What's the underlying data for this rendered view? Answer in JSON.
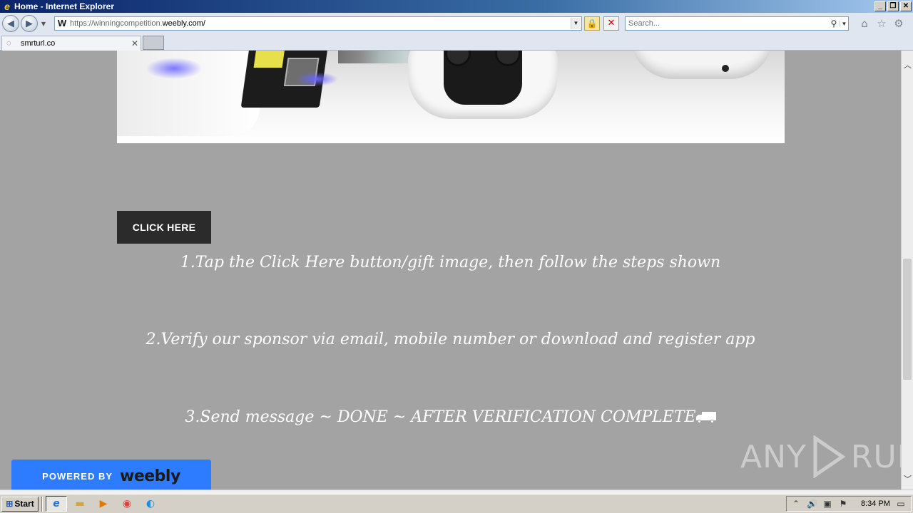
{
  "window": {
    "title": "Home - Internet Explorer",
    "controls": {
      "minimize": "_",
      "maximize": "❐",
      "close": "✕"
    }
  },
  "navbar": {
    "url_scheme": "https://",
    "url_sub": "winningcompetition.",
    "url_host": "weebly.com/",
    "site_icon": "W",
    "search_placeholder": "Search..."
  },
  "tabs": [
    {
      "label": "smrturl.co"
    }
  ],
  "page": {
    "cta_label": "CLICK HERE",
    "steps": [
      "1.Tap the Click Here button/gift image, then follow the steps shown",
      "2.Verify our sponsor via email, mobile number or download and register app",
      "3.Send message ~ DONE ~ AFTER VERIFICATION COMPLETE"
    ],
    "powered_label": "POWERED BY",
    "powered_brand": "weebly"
  },
  "watermark": {
    "left": "ANY",
    "right": "RUN"
  },
  "taskbar": {
    "start_label": "Start",
    "clock": "8:34 PM"
  },
  "icons": {
    "back": "back-arrow-icon",
    "forward": "forward-arrow-icon",
    "home": "home-icon",
    "favorites": "star-icon",
    "tools": "gear-icon",
    "lock": "lock-icon",
    "stop": "stop-icon",
    "search": "search-icon"
  },
  "colors": {
    "page_bg": "#a3a3a3",
    "cta_bg": "#2b2b2b",
    "weebly_blue": "#2d7cff"
  }
}
